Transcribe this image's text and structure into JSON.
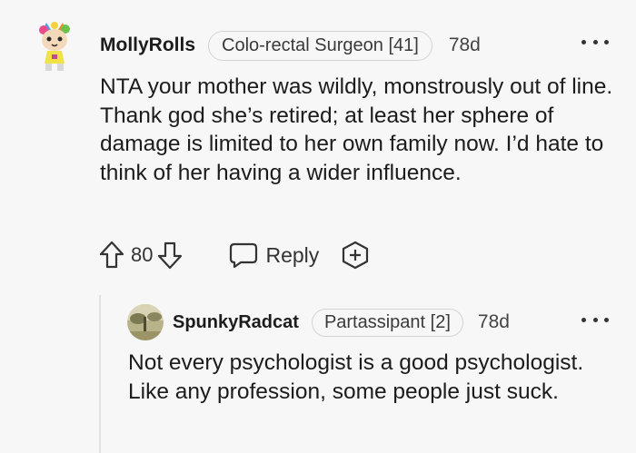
{
  "comment": {
    "username": "MollyRolls",
    "flair": "Colo-rectal Surgeon [41]",
    "age": "78d",
    "body": "NTA your mother was wildly, monstrously out of line. Thank god she’s retired; at least her sphere of damage is limited to her own family now. I’d hate to think of her having a wider influence.",
    "score": "80",
    "reply_label": "Reply",
    "icons": {
      "avatar": "cartoon-cat-avatar",
      "upvote": "upvote-arrow-icon",
      "downvote": "downvote-arrow-icon",
      "reply": "speech-bubble-icon",
      "award": "award-plus-icon",
      "more": "more-options-icon"
    }
  },
  "reply": {
    "username": "SpunkyRadcat",
    "flair": "Partassipant [2]",
    "age": "78d",
    "body": "Not every psychologist is a good psychologist. Like any profession, some people just suck.",
    "icons": {
      "avatar": "landscape-photo-avatar",
      "more": "more-options-icon"
    }
  },
  "colors": {
    "background": "#f7f7f7",
    "text": "#1c1c1c",
    "muted": "#444444",
    "flair_border": "#d4d4d4",
    "thread_line": "#e2e2e2"
  }
}
